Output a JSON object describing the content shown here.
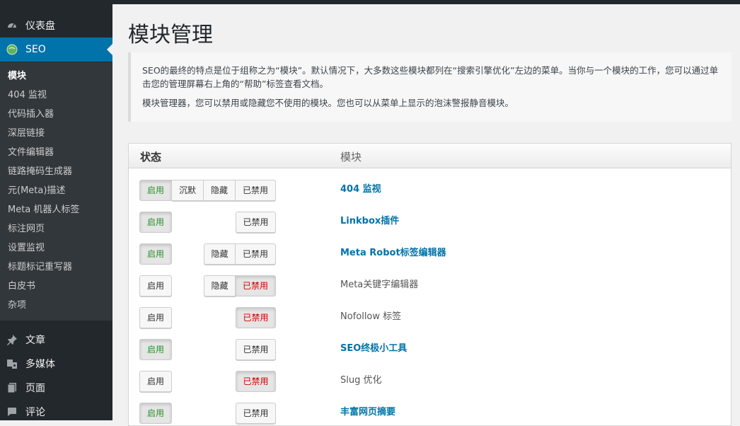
{
  "colors": {
    "accent": "#0073aa",
    "sidebar": "#23282d",
    "enabled": "#2a8f2a",
    "disabled": "#d40000"
  },
  "sidebar": {
    "dashboard": {
      "label": "仪表盘",
      "icon": "dashboard-icon"
    },
    "seo": {
      "label": "SEO",
      "icon": "seo-icon"
    },
    "submenu": [
      "模块",
      "404 监视",
      "代码插入器",
      "深层链接",
      "文件编辑器",
      "链路掩码生成器",
      "元(Meta)描述",
      "Meta 机器人标签",
      "标注网页",
      "设置监视",
      "标题标记重写器",
      "白皮书",
      "杂项"
    ],
    "posts": {
      "label": "文章",
      "icon": "pin-icon"
    },
    "media": {
      "label": "多媒体",
      "icon": "media-icon"
    },
    "pages": {
      "label": "页面",
      "icon": "page-icon"
    },
    "comments": {
      "label": "评论",
      "icon": "comment-icon"
    }
  },
  "page": {
    "title": "模块管理",
    "help": [
      "SEO的最终的特点是位于组称之为“模块”。默认情况下，大多数这些模块都列在“搜索引擎优化”左边的菜单。当你与一个模块的工作，您可以通过单击您的管理屏幕右上角的“帮助”标签查看文档。",
      "模块管理器，您可以禁用或隐藏您不使用的模块。您也可以从菜单上显示的泡沫警报静音模块。"
    ]
  },
  "table": {
    "headers": {
      "status": "状态",
      "module": "模块"
    },
    "labels": {
      "enable": "启用",
      "silent": "沉默",
      "hide": "隐藏",
      "disable": "已禁用"
    },
    "rows": [
      {
        "name": "404 监视",
        "state": "enabled",
        "buttons": [
          "enable",
          "silent",
          "hide",
          "disable"
        ]
      },
      {
        "name": "Linkbox插件",
        "state": "enabled",
        "buttons": [
          "enable",
          "disable"
        ]
      },
      {
        "name": "Meta Robot标签编辑器",
        "state": "enabled",
        "buttons": [
          "enable",
          "hide",
          "disable"
        ]
      },
      {
        "name": "Meta关键字编辑器",
        "state": "disabled",
        "buttons": [
          "enable",
          "hide",
          "disable"
        ]
      },
      {
        "name": "Nofollow 标签",
        "state": "disabled",
        "buttons": [
          "enable",
          "disable"
        ]
      },
      {
        "name": "SEO终极小工具",
        "state": "enabled",
        "buttons": [
          "enable",
          "disable"
        ]
      },
      {
        "name": "Slug 优化",
        "state": "disabled",
        "buttons": [
          "enable",
          "disable"
        ]
      },
      {
        "name": "丰富网页摘要",
        "state": "enabled",
        "buttons": [
          "enable",
          "disable"
        ]
      }
    ]
  }
}
